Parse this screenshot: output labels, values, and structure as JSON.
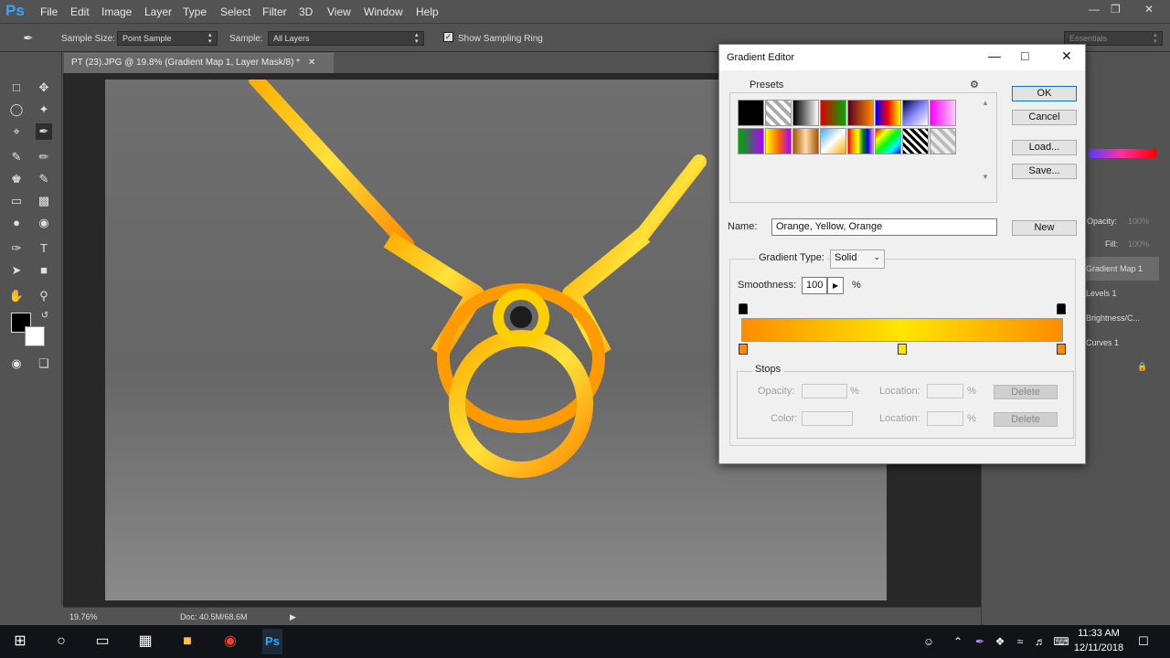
{
  "app": {
    "logo": "Ps",
    "menus": [
      "File",
      "Edit",
      "Image",
      "Layer",
      "Type",
      "Select",
      "Filter",
      "3D",
      "View",
      "Window",
      "Help"
    ]
  },
  "options_bar": {
    "sample_size_label": "Sample Size:",
    "sample_size_value": "Point Sample",
    "sample_label": "Sample:",
    "sample_value": "All Layers",
    "show_sampling_ring": "Show Sampling Ring",
    "workspace": "Essentials"
  },
  "document": {
    "tab_title": "PT (23).JPG @ 19.8% (Gradient Map 1, Layer Mask/8) *",
    "zoom": "19.76%",
    "doc_size": "Doc: 40.5M/68.6M"
  },
  "layers": {
    "opacity_label": "Opacity:",
    "opacity_value": "100%",
    "fill_label": "Fill:",
    "fill_value": "100%",
    "items": [
      "Gradient Map 1",
      "Levels 1",
      "Brightness/C...",
      "Curves 1"
    ]
  },
  "dialog": {
    "title": "Gradient Editor",
    "presets_label": "Presets",
    "ok": "OK",
    "cancel": "Cancel",
    "load": "Load...",
    "save": "Save...",
    "name_label": "Name:",
    "name_value": "Orange, Yellow, Orange",
    "new_button": "New",
    "gradient_type_label": "Gradient Type:",
    "gradient_type_value": "Solid",
    "smoothness_label": "Smoothness:",
    "smoothness_value": "100",
    "percent": "%",
    "stops_label": "Stops",
    "opacity_label": "Opacity:",
    "color_label": "Color:",
    "location_label": "Location:",
    "delete_button": "Delete",
    "gradient_colors": [
      "#ff8c00",
      "#ffe600",
      "#ff8c00"
    ]
  },
  "taskbar": {
    "time": "11:33 AM",
    "date": "12/11/2018"
  }
}
